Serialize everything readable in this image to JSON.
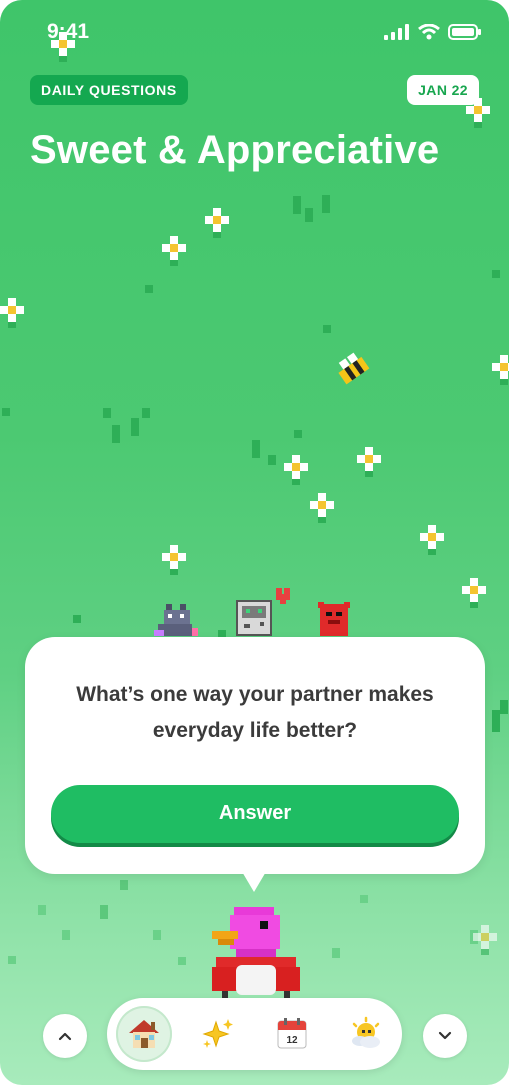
{
  "status_bar": {
    "time": "9:41"
  },
  "header": {
    "category_label": "DAILY QUESTIONS",
    "date_label": "JAN 22",
    "title": "Sweet & Appreciative"
  },
  "question_card": {
    "question": "What’s one way your partner makes everyday life better?",
    "answer_button_label": "Answer"
  },
  "bottom_nav": {
    "items": [
      {
        "icon": "home-icon",
        "active": true
      },
      {
        "icon": "sparkles-icon",
        "active": false
      },
      {
        "icon": "calendar-icon",
        "calendar_day": "12",
        "active": false
      },
      {
        "icon": "weather-icon",
        "active": false
      }
    ],
    "scroll_up_icon": "chevron-up-icon",
    "scroll_down_icon": "chevron-down-icon"
  },
  "colors": {
    "accent_green": "#1fbd63",
    "chip_green": "#14a850",
    "background_green": "#4cc972"
  }
}
